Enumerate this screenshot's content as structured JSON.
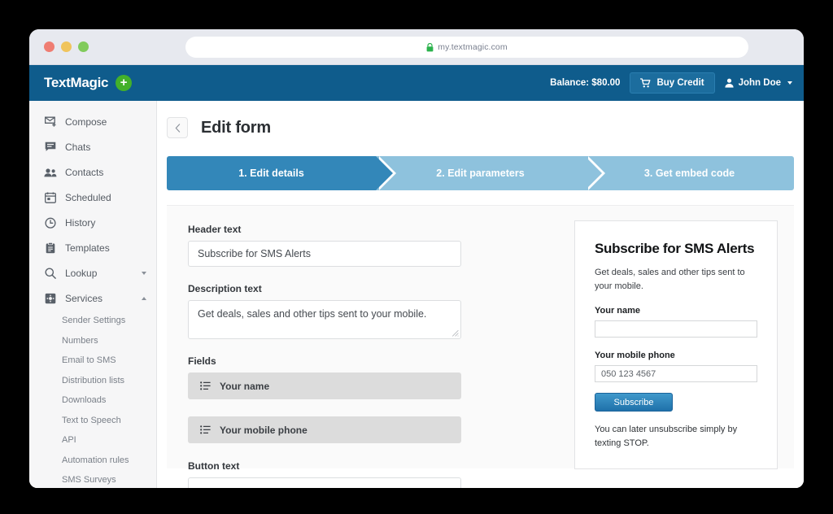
{
  "browser": {
    "traffic_lights": [
      "close",
      "minimize",
      "maximize"
    ],
    "url": "my.textmagic.com",
    "lock_icon": "padlock-icon"
  },
  "navbar": {
    "brand": "TextMagic",
    "brand_badge": "+",
    "balance_label": "Balance: $80.00",
    "buy_credit_label": "Buy Credit",
    "buy_credit_icon": "cart-icon",
    "user_name": "John Doe",
    "user_icon": "person-icon",
    "bg_color": "#0f5c8c",
    "buy_credit_color": "#1c6d9e",
    "badge_color": "#43b02a"
  },
  "sidebar": {
    "items": [
      {
        "label": "Compose",
        "icon": "compose-envelope-icon",
        "arrow": ""
      },
      {
        "label": "Chats",
        "icon": "chat-bubble-icon",
        "arrow": ""
      },
      {
        "label": "Contacts",
        "icon": "contacts-people-icon",
        "arrow": ""
      },
      {
        "label": "Scheduled",
        "icon": "calendar-icon",
        "arrow": ""
      },
      {
        "label": "History",
        "icon": "clock-history-icon",
        "arrow": ""
      },
      {
        "label": "Templates",
        "icon": "clipboard-icon",
        "arrow": ""
      },
      {
        "label": "Lookup",
        "icon": "search-icon",
        "arrow": "down"
      },
      {
        "label": "Services",
        "icon": "gear-box-icon",
        "arrow": "up"
      }
    ],
    "sub_items": [
      {
        "label": "Sender Settings"
      },
      {
        "label": "Numbers"
      },
      {
        "label": "Email to SMS"
      },
      {
        "label": "Distribution lists"
      },
      {
        "label": "Downloads"
      },
      {
        "label": "Text to Speech"
      },
      {
        "label": "API"
      },
      {
        "label": "Automation rules"
      },
      {
        "label": "SMS Surveys"
      }
    ]
  },
  "page": {
    "back_icon": "chevron-left-icon",
    "title": "Edit form"
  },
  "steps": {
    "active_color": "#3387b9",
    "idle_color": "#8ec2dd",
    "items": [
      {
        "label": "1. Edit details",
        "state": "active"
      },
      {
        "label": "2. Edit parameters",
        "state": "idle"
      },
      {
        "label": "3. Get embed code",
        "state": "idle"
      }
    ]
  },
  "editor": {
    "header_text_label": "Header text",
    "header_text_value": "Subscribe for SMS Alerts",
    "description_text_label": "Description text",
    "description_text_value": "Get deals, sales and other tips sent to your mobile.",
    "fields_label": "Fields",
    "fields": [
      {
        "label": "Your name",
        "icon": "drag-list-icon"
      },
      {
        "label": "Your mobile phone",
        "icon": "drag-list-icon"
      }
    ],
    "button_text_label": "Button text",
    "button_text_value": ""
  },
  "preview": {
    "title": "Subscribe for SMS Alerts",
    "description": "Get deals, sales and other tips sent to your mobile.",
    "name_label": "Your name",
    "name_value": "",
    "phone_label": "Your mobile phone",
    "phone_value": "050 123 4567",
    "submit_label": "Subscribe",
    "note": "You can later unsubscribe simply by texting STOP.",
    "submit_color": "#2b7fb5"
  }
}
